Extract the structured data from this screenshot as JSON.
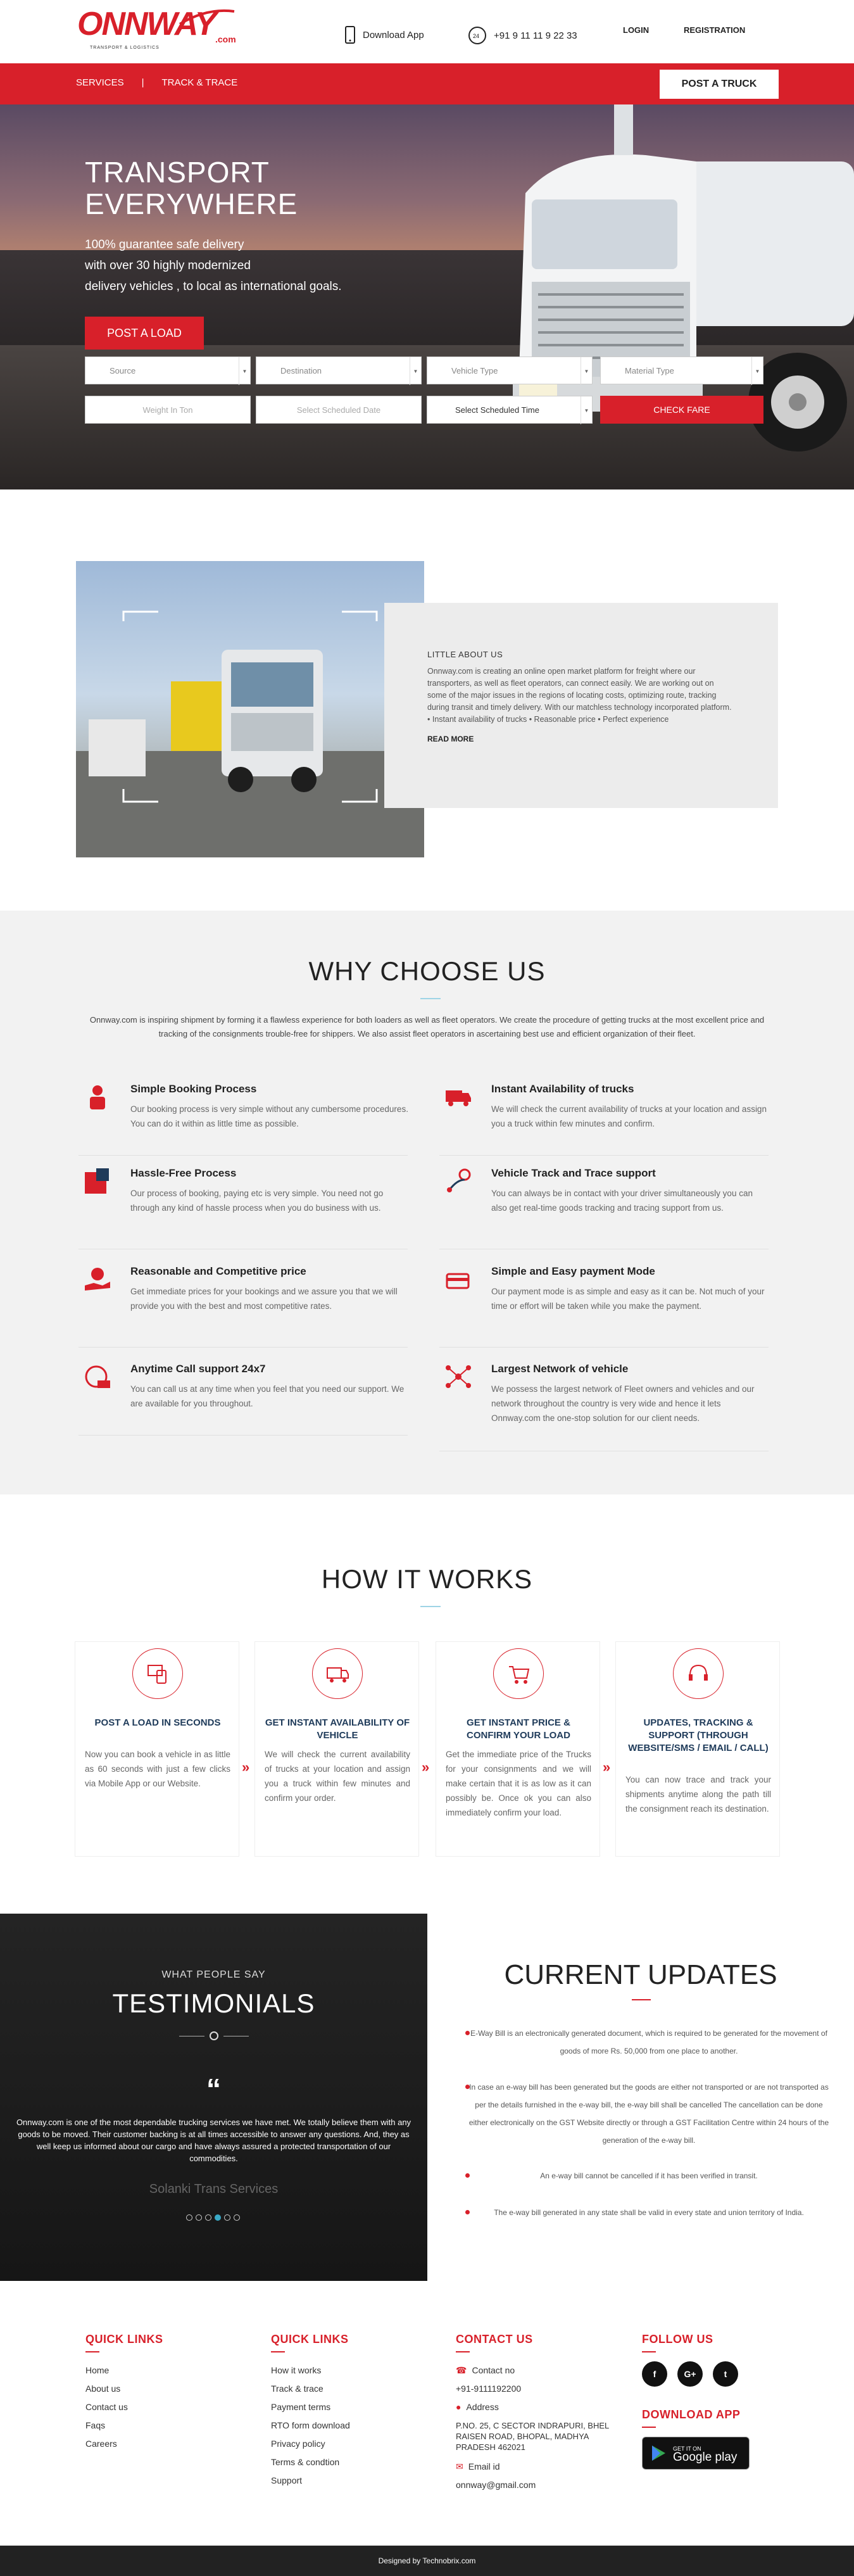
{
  "header": {
    "logo_text": "ONNWAY",
    "logo_com": ".com",
    "logo_tagline": "TRANSPORT & LOGISTICS",
    "download_app": "Download App",
    "phone": "+91 9 11 11 9 22 33",
    "login": "LOGIN",
    "registration": "REGISTRATION"
  },
  "redbar": {
    "services": "SERVICES",
    "divider": "|",
    "track": "TRACK & TRACE",
    "post_truck": "POST A TRUCK"
  },
  "hero": {
    "title_line1": "TRANSPORT",
    "title_line2": "EVERYWHERE",
    "sub_line1": "100% guarantee safe delivery",
    "sub_line2": "with over 30 highly modernized",
    "sub_line3": "delivery vehicles , to local as international goals.",
    "post_load": "POST A LOAD",
    "source": "Source",
    "destination": "Destination",
    "vehicle_type": "Vehicle Type",
    "material_type": "Material Type",
    "weight": "Weight In Ton",
    "date": "Select Scheduled Date",
    "time": "Select Scheduled Time",
    "check_fare": "CHECK FARE"
  },
  "about": {
    "heading": "LITTLE ABOUT US",
    "text": "Onnway.com is creating an online open market platform for freight where our transporters, as well as fleet operators, can connect easily. We are working out on some of the major issues in the regions of locating costs, optimizing route, tracking during transit and timely delivery. With our matchless technology incorporated platform. • Instant availability of trucks • Reasonable price • Perfect experience",
    "read_more": "READ MORE"
  },
  "why": {
    "title": "WHY CHOOSE US",
    "intro": "Onnway.com is inspiring shipment by forming it a flawless experience for both loaders as well as fleet operators. We create the procedure of getting trucks at the most excellent price and tracking of the consignments trouble-free for shippers. We also assist fleet operators in ascertaining best use and efficient organization of their fleet.",
    "features": [
      {
        "title": "Simple Booking Process",
        "text": "Our booking process is very simple without any cumbersome procedures. You can do it within as little time as possible.",
        "icon": "booking-icon"
      },
      {
        "title": "Instant Availability of trucks",
        "text": "We will check the current availability of trucks at your location and assign you a truck within few minutes and confirm.",
        "icon": "truck-icon"
      },
      {
        "title": "Hassle-Free Process",
        "text": "Our process of booking, paying etc is very simple. You need not go through any kind of hassle process when you do business with us.",
        "icon": "puzzle-icon"
      },
      {
        "title": "Vehicle Track and Trace support",
        "text": "You can always be in contact with your driver simultaneously you can also get real-time goods tracking and tracing support from us.",
        "icon": "route-icon"
      },
      {
        "title": "Reasonable and Competitive price",
        "text": "Get immediate prices for your bookings and we assure you that we will provide you with the best and most competitive rates.",
        "icon": "price-icon"
      },
      {
        "title": "Simple and Easy payment Mode",
        "text": "Our payment mode is as simple and easy as it can be. Not much of your time or effort will be taken while you make the payment.",
        "icon": "payment-icon"
      },
      {
        "title": "Anytime Call support 24x7",
        "text": "You can call us at any time when you feel that you need our support. We are available for you throughout.",
        "icon": "support-24-icon"
      },
      {
        "title": "Largest Network of vehicle",
        "text": "We possess the largest network of Fleet owners and vehicles and our network throughout the country is very wide and hence it lets Onnway.com the one-stop solution for our client needs.",
        "icon": "network-icon"
      }
    ]
  },
  "how": {
    "title": "HOW IT WORKS",
    "steps": [
      {
        "title": "POST A LOAD IN SECONDS",
        "text": "Now you can book a vehicle in as little as 60 seconds with just a few clicks via Mobile App or our Website."
      },
      {
        "title": "GET INSTANT AVAILABILITY OF VEHICLE",
        "text": "We will check the current availability of trucks at your location and assign you a truck within few minutes and confirm your order."
      },
      {
        "title": "GET INSTANT PRICE & CONFIRM YOUR LOAD",
        "text": "Get the immediate price of the Trucks for your consignments and we will make certain that it is as low as it can possibly be. Once ok you can also immediately confirm your load."
      },
      {
        "title": "UPDATES, TRACKING & SUPPORT (THROUGH WEBSITE/SMS / EMAIL / CALL)",
        "text": "You can now trace and track your shipments anytime along the path till the consignment reach its destination."
      }
    ],
    "arrow": "»"
  },
  "testimonials": {
    "kicker": "WHAT PEOPLE SAY",
    "title": "TESTIMONIALS",
    "quote_mark": "“",
    "quote": "Onnway.com is one of the most dependable trucking services we have met. We totally believe them with any goods to be moved. Their customer backing is at all times accessible to answer any questions. And, they as well keep us informed about our cargo and have always assured a protected transportation of our commodities.",
    "author": "Solanki Trans Services"
  },
  "updates": {
    "title": "CURRENT UPDATES",
    "items": [
      "E-Way Bill is an electronically generated document, which is required to be generated for the movement of goods of more Rs. 50,000 from one place to another.",
      "In case an e-way bill has been generated but the goods are either not transported or are not transported as per the details furnished in the e-way bill, the e-way bill shall be cancelled The cancellation can be done either electronically on the GST Website directly or through a GST Facilitation Centre within 24 hours of the generation of the e-way bill.",
      "An e-way bill cannot be cancelled if it has been verified in transit.",
      "The e-way bill generated in any state shall be valid in every state and union territory of India."
    ]
  },
  "footer": {
    "quick1": {
      "title": "QUICK LINKS",
      "items": [
        "Home",
        "About us",
        "Contact us",
        "Faqs",
        "Careers"
      ]
    },
    "quick2": {
      "title": "QUICK LINKS",
      "items": [
        "How it works",
        "Track & trace",
        "Payment terms",
        "RTO form download",
        "Privacy policy",
        "Terms & condtion",
        "Support"
      ]
    },
    "contact": {
      "title": "CONTACT US",
      "contact_no_label": "Contact no",
      "phone": "+91-9111192200",
      "address_label": "Address",
      "address": "P.NO. 25, C SECTOR INDRAPURI, BHEL RAISEN ROAD, BHOPAL, MADHYA PRADESH 462021",
      "email_label": "Email id",
      "email": "onnway@gmail.com"
    },
    "follow": {
      "title": "FOLLOW US",
      "fb": "f",
      "gplus": "G+",
      "tw": "t"
    },
    "download": {
      "title": "DOWNLOAD APP",
      "get_it_on": "GET IT ON",
      "store": "Google play"
    },
    "credit": "Designed by Technobrix.com"
  },
  "colors": {
    "brand_red": "#d8202a",
    "dark": "#222222"
  }
}
